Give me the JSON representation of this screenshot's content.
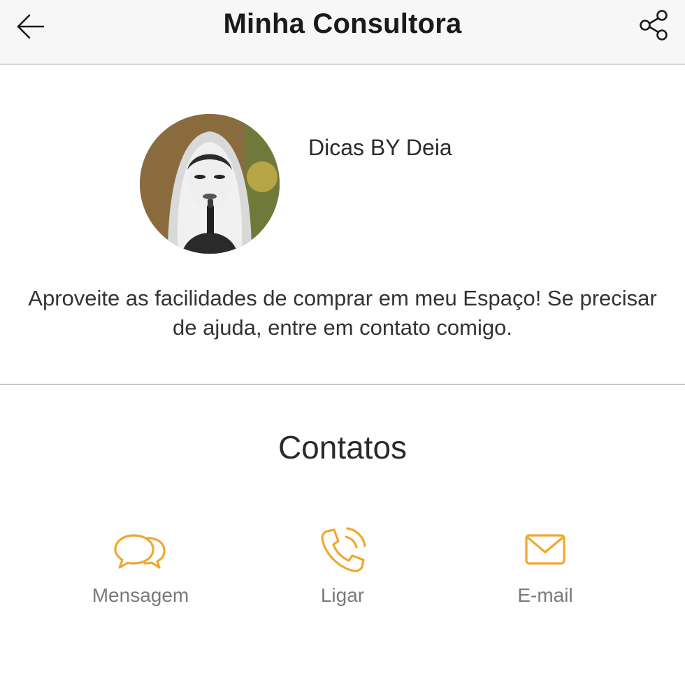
{
  "header": {
    "title": "Minha Consultora",
    "back_icon": "arrow-left-icon",
    "share_icon": "share-icon"
  },
  "profile": {
    "name": "Dicas BY Deia",
    "bio": "Aproveite as facilidades de comprar em meu Espaço! Se precisar de ajuda, entre em contato comigo."
  },
  "contacts": {
    "title": "Contatos",
    "accent_color": "#f0a830",
    "items": [
      {
        "label": "Mensagem",
        "icon": "chat-bubbles-icon"
      },
      {
        "label": "Ligar",
        "icon": "phone-icon"
      },
      {
        "label": "E-mail",
        "icon": "envelope-icon"
      }
    ]
  }
}
